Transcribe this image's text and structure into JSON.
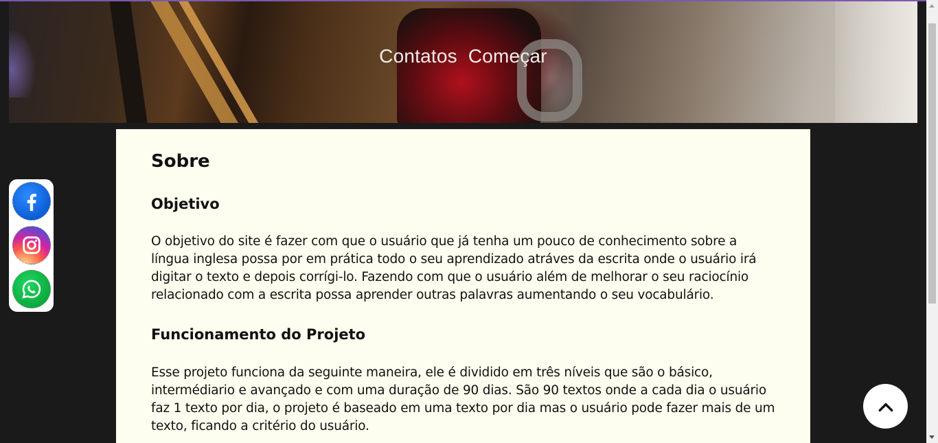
{
  "header": {
    "nav": [
      {
        "label": "Contatos"
      },
      {
        "label": "Começar"
      }
    ]
  },
  "content": {
    "title": "Sobre",
    "sections": [
      {
        "heading": "Objetivo",
        "text": "O objetivo do site é fazer com que o usuário que já tenha um pouco de conhecimento sobre a língua inglesa possa por em prática todo o seu aprendizado atráves da escrita onde o usuário irá digitar o texto e depois corrígi-lo. Fazendo com que o usuário além de melhorar o seu raciocínio relacionado com a escrita possa aprender outras palavras aumentando o seu vocabulário."
      },
      {
        "heading": "Funcionamento do Projeto",
        "text": "Esse projeto funciona da seguinte maneira, ele é dividido em três níveis que são o básico, intermédiario e avançado e com uma duração de 90 dias. São 90 textos onde a cada dia o usuário faz 1 texto por dia, o projeto é baseado em uma texto por dia mas o usuário pode fazer mais de um texto, ficando a critério do usuário."
      }
    ]
  },
  "social": {
    "items": [
      {
        "icon": "facebook-icon",
        "color": "#0b5ed7"
      },
      {
        "icon": "instagram-icon",
        "color": "#d6249f"
      },
      {
        "icon": "whatsapp-icon",
        "color": "#0aa83b"
      }
    ]
  },
  "colors": {
    "background": "#1b1a1b",
    "content_bg": "#fdfeef",
    "accent_line": "#7b59b0"
  },
  "back_to_top": {
    "icon": "chevron-up-icon"
  }
}
